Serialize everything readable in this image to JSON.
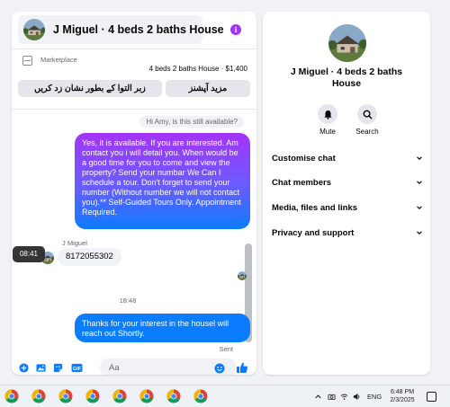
{
  "chat": {
    "title": "J Miguel · 4 beds 2 baths House",
    "marketplace_label": "Marketplace",
    "listing": "4 beds 2 baths House · $1,400",
    "quick_replies": [
      "زبر التوا کے بطور نشان زد کریں",
      "مزید آپشنز"
    ],
    "quoted_message": "Hi Amy, is this still available?",
    "sent_message_1": "Yes, it is available. If you are interested. Am contact you i will detail you.  When would be a good time for you to come and view the property? Send your numbar We Can I schedule a tour.  Don't forget to send your number (Without number we will not contact you).** Self-Guided Tours Only. Appointment Required.",
    "sender_name": "J Miguel",
    "received_message": "8172055302",
    "hover_time": "08:41",
    "divider_time": "18:48",
    "sent_message_2": "Thanks for your interest in the housel will reach out Shortly.",
    "sent_status": "Sent",
    "input_placeholder": "Aa",
    "composer_icons": [
      "plus-circle-icon",
      "image-icon",
      "sticker-icon",
      "gif-icon",
      "emoji-icon",
      "thumbs-up-icon"
    ]
  },
  "profile": {
    "name": "J Miguel · 4 beds 2 baths House",
    "actions": [
      {
        "label": "Mute",
        "icon": "bell-icon"
      },
      {
        "label": "Search",
        "icon": "search-icon"
      }
    ],
    "sections": [
      "Customise chat",
      "Chat members",
      "Media, files and links",
      "Privacy and support"
    ]
  },
  "taskbar": {
    "apps": [
      "chrome-icon",
      "chrome-icon",
      "chrome-icon",
      "chrome-icon",
      "chrome-icon",
      "chrome-icon",
      "chrome-icon",
      "chrome-icon"
    ],
    "language": "ENG",
    "time": "6:48 PM",
    "date": "2/3/2025"
  },
  "colors": {
    "messenger_blue": "#0a7cff",
    "gradient_purple": "#a334fa",
    "accent_purple": "#a033ff",
    "background": "#f0f2f5"
  }
}
